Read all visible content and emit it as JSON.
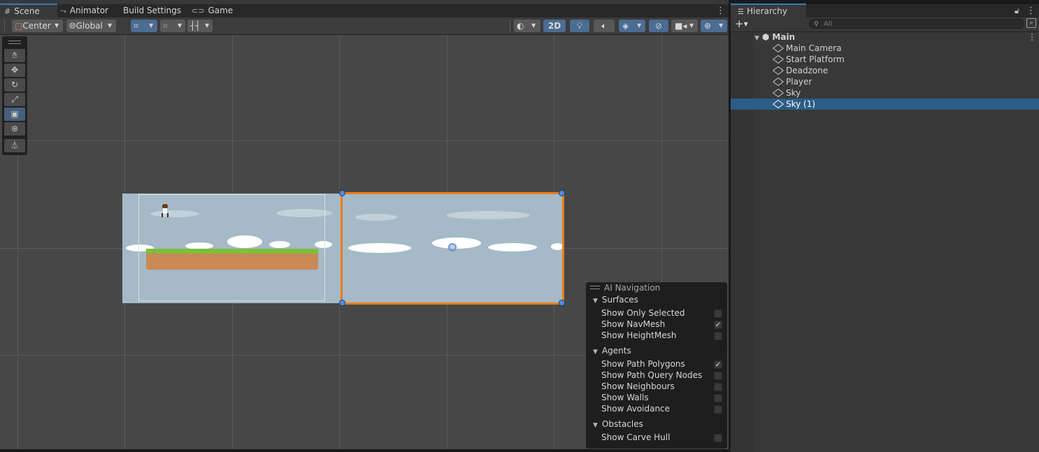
{
  "scene_tabs": [
    {
      "label": "Scene",
      "icon": "grid-icon"
    },
    {
      "label": "Animator",
      "icon": "animator-icon"
    },
    {
      "label": "Build Settings",
      "icon": ""
    },
    {
      "label": "Game",
      "icon": "gamepad-icon"
    }
  ],
  "toolbar": {
    "pivot_label": "Center",
    "space_label": "Global",
    "mode_2d_label": "2D"
  },
  "ai_navigation": {
    "title": "AI Navigation",
    "surfaces": {
      "header": "Surfaces",
      "items": [
        {
          "label": "Show Only Selected",
          "checked": false
        },
        {
          "label": "Show NavMesh",
          "checked": true
        },
        {
          "label": "Show HeightMesh",
          "checked": false
        }
      ]
    },
    "agents": {
      "header": "Agents",
      "items": [
        {
          "label": "Show Path Polygons",
          "checked": true
        },
        {
          "label": "Show Path Query Nodes",
          "checked": false
        },
        {
          "label": "Show Neighbours",
          "checked": false
        },
        {
          "label": "Show Walls",
          "checked": false
        },
        {
          "label": "Show Avoidance",
          "checked": false
        }
      ]
    },
    "obstacles": {
      "header": "Obstacles",
      "items": [
        {
          "label": "Show Carve Hull",
          "checked": false
        }
      ]
    }
  },
  "hierarchy": {
    "tab_label": "Hierarchy",
    "search_placeholder": "All",
    "scene_name": "Main",
    "objects": [
      {
        "label": "Main Camera",
        "selected": false
      },
      {
        "label": "Start Platform",
        "selected": false
      },
      {
        "label": "Deadzone",
        "selected": false
      },
      {
        "label": "Player",
        "selected": false
      },
      {
        "label": "Sky",
        "selected": false
      },
      {
        "label": "Sky (1)",
        "selected": true
      }
    ]
  },
  "colors": {
    "selection_outline": "#f07c16",
    "selected_row": "#2c5d87",
    "active_tab_accent": "#3a79bb",
    "sky": "#a5b9c6",
    "grass": "#7cbf3a",
    "dirt": "#c98a56"
  }
}
